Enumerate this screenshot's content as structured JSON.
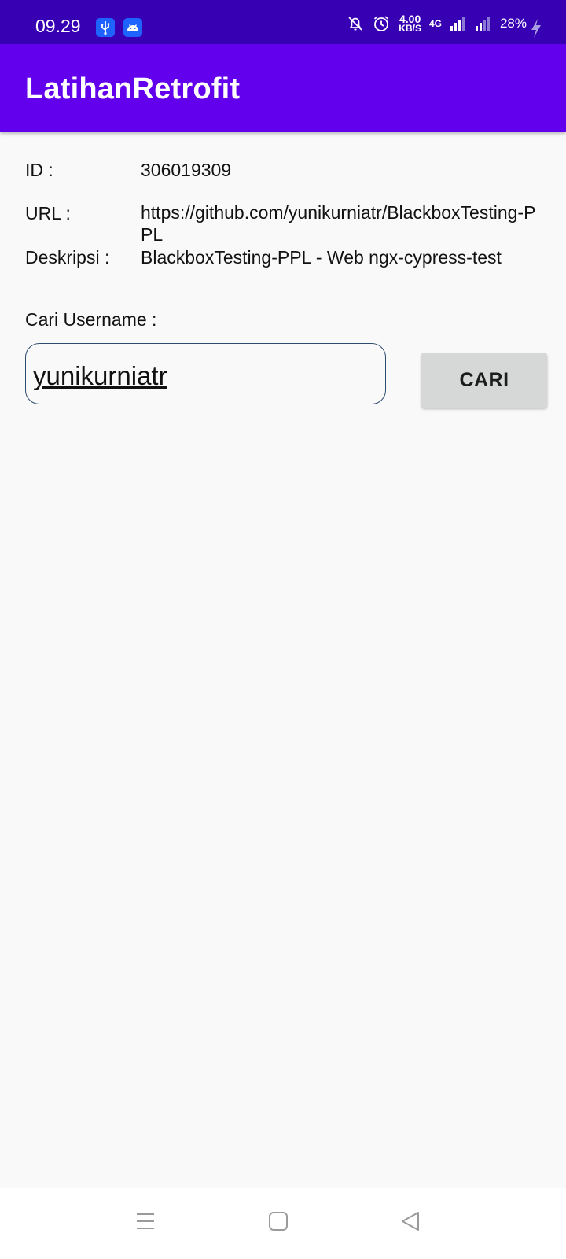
{
  "status_bar": {
    "time": "09.29",
    "speed_value": "4.00",
    "speed_unit": "KB/S",
    "network": "4G",
    "battery": "28%",
    "icons": [
      "usb-icon",
      "android-icon",
      "mute-bell-icon",
      "alarm-icon",
      "signal-icon",
      "signal-icon-2",
      "charging-icon"
    ]
  },
  "app_bar": {
    "title": "LatihanRetrofit"
  },
  "details": {
    "id_label": "ID :",
    "id_value": "306019309",
    "url_label": "URL :",
    "url_value": "https://github.com/yunikurniatr/BlackboxTesting-PPL",
    "desc_label": "Deskripsi :",
    "desc_value": "BlackboxTesting-PPL - Web ngx-cypress-test"
  },
  "search": {
    "label": "Cari Username :",
    "value": "yunikurniatr",
    "button_label": "CARI"
  },
  "nav_bar": {
    "icons": [
      "menu-icon",
      "home-icon",
      "back-icon"
    ]
  },
  "colors": {
    "status_bar": "#3700b3",
    "app_bar": "#6200ee",
    "background": "#f9f9f9",
    "button": "#d6d7d7"
  }
}
